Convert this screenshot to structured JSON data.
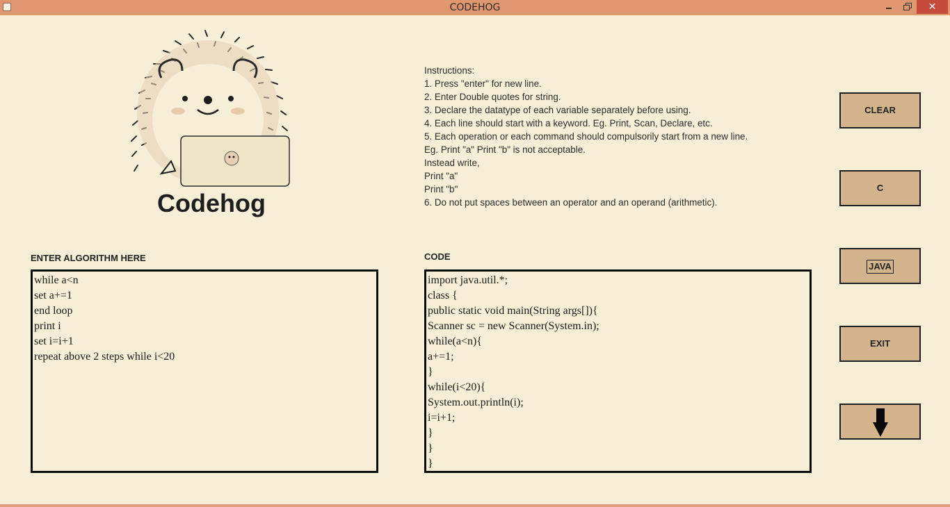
{
  "window": {
    "title": "CODEHOG",
    "controls": {
      "minimize": "minimize-icon",
      "maximize": "restore-icon",
      "close": "close-icon"
    }
  },
  "logo": {
    "text": "Codehog"
  },
  "instructions": {
    "lines": [
      "Instructions:",
      "1. Press \"enter\" for new line.",
      "2. Enter Double quotes for string.",
      "3. Declare the datatype of each variable separately before using.",
      "4. Each line should start with a keyword. Eg. Print, Scan, Declare, etc.",
      "5. Each operation or each command should compulsorily start from a new line.",
      "Eg. Print \"a\" Print \"b\" is not acceptable.",
      "Instead write,",
      "Print \"a\"",
      "Print \"b\"",
      "6. Do not put spaces between an operator and an operand (arithmetic)."
    ]
  },
  "algorithm": {
    "label": "ENTER ALGORITHM HERE",
    "lines": [
      "while a<n",
      "set a+=1",
      "end loop",
      "print i",
      "set i=i+1",
      "repeat above 2 steps while i<20"
    ]
  },
  "code": {
    "label": "CODE",
    "lines": [
      "import java.util.*;",
      "class {",
      "public static void main(String args[]){",
      "Scanner sc = new Scanner(System.in);",
      "while(a<n){",
      "a+=1;",
      "}",
      "while(i<20){",
      "System.out.println(i);",
      "i=i+1;",
      "}",
      "}",
      "}"
    ]
  },
  "buttons": {
    "clear": "CLEAR",
    "c": "C",
    "java": "JAVA",
    "exit": "EXIT",
    "down": "down-arrow-icon"
  },
  "colors": {
    "background": "#f6eed7",
    "titlebar": "#e0976f",
    "button": "#d4b48c",
    "close": "#c74b3b"
  }
}
